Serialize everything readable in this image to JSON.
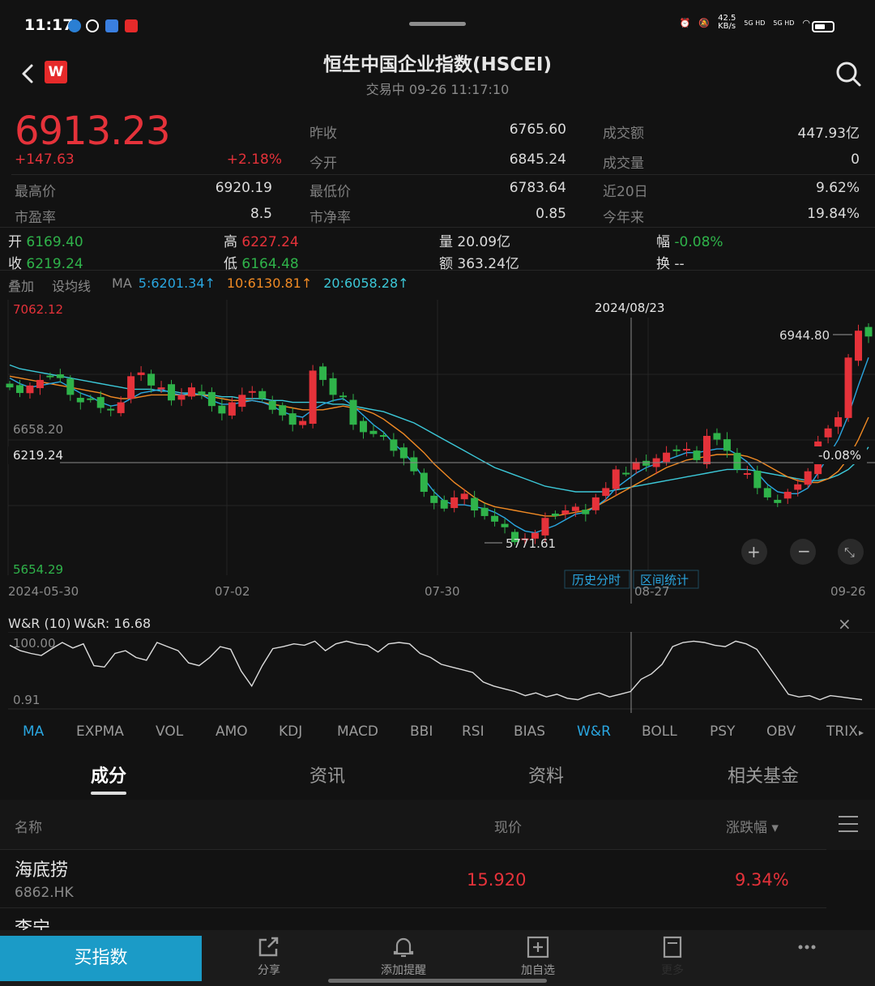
{
  "status_bar": {
    "time": "11:17",
    "net_speed": "42.5\nKB/s",
    "signal1": "5G HD",
    "signal2": "5G HD"
  },
  "header": {
    "title": "恒生中国企业指数(HSCEI)",
    "status": "交易中 09-26 11:17:10",
    "logo": "W"
  },
  "quote": {
    "price": "6913.23",
    "change_abs": "+147.63",
    "change_pct": "+2.18%",
    "fields": [
      {
        "label": "昨收",
        "value": "6765.60"
      },
      {
        "label": "今开",
        "value": "6845.24"
      },
      {
        "label": "成交额",
        "value": "447.93亿"
      },
      {
        "label": "成交量",
        "value": "0"
      },
      {
        "label": "最高价",
        "value": "6920.19"
      },
      {
        "label": "最低价",
        "value": "6783.64"
      },
      {
        "label": "近20日",
        "value": "9.62%"
      },
      {
        "label": "市盈率",
        "value": "8.5"
      },
      {
        "label": "市净率",
        "value": "0.85"
      },
      {
        "label": "今年来",
        "value": "19.84%"
      }
    ]
  },
  "candle_info": {
    "open_label": "开",
    "open": "6169.40",
    "high_label": "高",
    "high": "6227.24",
    "volume_label": "量",
    "volume": "20.09亿",
    "amp_label": "幅",
    "amp": "-0.08%",
    "close_label": "收",
    "close": "6219.24",
    "low_label": "低",
    "low": "6164.48",
    "amount_label": "额",
    "amount": "363.24亿",
    "turnover_label": "换",
    "turnover": "--"
  },
  "ma_legend": {
    "overlay": "叠加",
    "set_ma": "设均线",
    "ma": "MA",
    "ma5": "5:6201.34↑",
    "ma10": "10:6130.81↑",
    "ma20": "20:6058.28↑",
    "ma5_color": "#2aa6e0",
    "ma10_color": "#f08a24",
    "ma20_color": "#3cc8d8"
  },
  "kline": {
    "y_max_label": "7062.12",
    "y_min_label": "5654.29",
    "y_mid_label": "6658.20",
    "cursor_price": "6219.24",
    "cursor_date": "2024/08/23",
    "cursor_pct": "-0.08%",
    "high_marker": "6944.80",
    "low_marker": "5771.61",
    "x_labels": [
      "2024-05-30",
      "07-02",
      "07-30",
      "08-27",
      "09-26"
    ],
    "btn_history": "历史分时",
    "btn_interval": "区间统计",
    "up_color": "#e5323a",
    "down_color": "#2fb34a"
  },
  "chart_data": {
    "type": "line",
    "title": "",
    "candles_close": [
      6640,
      6610,
      6650,
      6680,
      6700,
      6690,
      6600,
      6560,
      6580,
      6530,
      6520,
      6560,
      6700,
      6720,
      6650,
      6640,
      6570,
      6600,
      6640,
      6600,
      6540,
      6500,
      6560,
      6600,
      6620,
      6580,
      6520,
      6490,
      6440,
      6460,
      6730,
      6680,
      6600,
      6590,
      6440,
      6400,
      6390,
      6380,
      6300,
      6260,
      6190,
      6080,
      6020,
      5990,
      6050,
      6070,
      5980,
      5950,
      5920,
      5890,
      5810,
      5830,
      5860,
      5940,
      5950,
      5980,
      6000,
      5960,
      6050,
      6100,
      6200,
      6180,
      6240,
      6220,
      6260,
      6290,
      6300,
      6310,
      6250,
      6380,
      6360,
      6300,
      6200,
      6180,
      6100,
      6050,
      6020,
      6080,
      6120,
      6190,
      6350,
      6420,
      6480,
      6800,
      6944,
      6913
    ],
    "ma5": [
      6690,
      6660,
      6640,
      6650,
      6660,
      6670,
      6640,
      6610,
      6590,
      6560,
      6540,
      6550,
      6580,
      6610,
      6620,
      6630,
      6610,
      6600,
      6610,
      6600,
      6570,
      6550,
      6550,
      6560,
      6570,
      6560,
      6540,
      6510,
      6490,
      6480,
      6520,
      6550,
      6570,
      6580,
      6540,
      6490,
      6440,
      6400,
      6340,
      6290,
      6230,
      6150,
      6080,
      6030,
      6010,
      6010,
      6000,
      5990,
      5970,
      5940,
      5900,
      5870,
      5860,
      5880,
      5900,
      5930,
      5960,
      5970,
      6000,
      6040,
      6100,
      6140,
      6180,
      6210,
      6230,
      6250,
      6270,
      6290,
      6290,
      6300,
      6310,
      6310,
      6280,
      6240,
      6180,
      6120,
      6080,
      6070,
      6070,
      6100,
      6180,
      6270,
      6360,
      6490,
      6650,
      6800
    ],
    "ma10": [
      6700,
      6690,
      6680,
      6670,
      6660,
      6650,
      6640,
      6630,
      6620,
      6610,
      6590,
      6580,
      6580,
      6590,
      6600,
      6600,
      6600,
      6600,
      6600,
      6600,
      6590,
      6580,
      6570,
      6570,
      6570,
      6560,
      6550,
      6540,
      6530,
      6520,
      6520,
      6520,
      6530,
      6540,
      6530,
      6520,
      6500,
      6470,
      6430,
      6390,
      6340,
      6290,
      6230,
      6180,
      6130,
      6090,
      6050,
      6020,
      6000,
      5990,
      5980,
      5970,
      5960,
      5950,
      5950,
      5960,
      5970,
      5980,
      6000,
      6030,
      6060,
      6090,
      6120,
      6150,
      6180,
      6210,
      6230,
      6250,
      6260,
      6270,
      6280,
      6280,
      6280,
      6270,
      6250,
      6220,
      6190,
      6160,
      6140,
      6130,
      6130,
      6150,
      6190,
      6260,
      6360,
      6480
    ],
    "ma20": [
      6760,
      6740,
      6730,
      6720,
      6710,
      6700,
      6690,
      6680,
      6670,
      6660,
      6650,
      6640,
      6630,
      6630,
      6630,
      6620,
      6620,
      6610,
      6610,
      6600,
      6600,
      6590,
      6590,
      6580,
      6580,
      6580,
      6570,
      6570,
      6560,
      6560,
      6560,
      6560,
      6550,
      6550,
      6540,
      6530,
      6520,
      6510,
      6490,
      6470,
      6450,
      6420,
      6390,
      6360,
      6330,
      6300,
      6270,
      6240,
      6210,
      6190,
      6170,
      6150,
      6130,
      6110,
      6100,
      6090,
      6080,
      6080,
      6080,
      6080,
      6090,
      6100,
      6110,
      6120,
      6130,
      6140,
      6150,
      6160,
      6170,
      6180,
      6190,
      6200,
      6200,
      6200,
      6190,
      6180,
      6170,
      6160,
      6150,
      6140,
      6140,
      6150,
      6170,
      6200,
      6250,
      6320
    ],
    "ylim": [
      5654.29,
      7062.12
    ],
    "x_tick_labels": [
      "2024-05-30",
      "07-02",
      "07-30",
      "08-27",
      "09-26"
    ]
  },
  "wr": {
    "title": "W&R (10)",
    "value": "W&R: 16.68",
    "y_top": "100.00",
    "y_bottom": "0.91",
    "series": [
      90,
      82,
      78,
      75,
      85,
      94,
      86,
      92,
      60,
      58,
      78,
      82,
      72,
      68,
      94,
      88,
      82,
      64,
      60,
      72,
      88,
      84,
      52,
      30,
      60,
      85,
      88,
      92,
      90,
      96,
      82,
      92,
      96,
      92,
      90,
      80,
      92,
      94,
      92,
      78,
      72,
      62,
      58,
      54,
      50,
      36,
      30,
      26,
      22,
      16,
      20,
      14,
      18,
      12,
      10,
      16,
      20,
      14,
      18,
      22,
      40,
      48,
      62,
      88,
      94,
      96,
      94,
      90,
      88,
      96,
      92,
      84,
      62,
      40,
      18,
      14,
      16,
      10,
      16,
      14,
      12,
      10
    ],
    "close_icon": "×"
  },
  "indicator_tabs": [
    "MA",
    "EXPMA",
    "VOL",
    "AMO",
    "KDJ",
    "MACD",
    "BBI",
    "RSI",
    "BIAS",
    "W&R",
    "BOLL",
    "PSY",
    "OBV",
    "TRIX"
  ],
  "section_tabs": [
    "成分",
    "资讯",
    "资料",
    "相关基金"
  ],
  "list": {
    "col_name": "名称",
    "col_price": "现价",
    "col_change": "涨跌幅 ▾",
    "rows": [
      {
        "name": "海底捞",
        "code": "6862.HK",
        "price": "15.920",
        "change": "9.34%"
      },
      {
        "name": "李宁",
        "code": "",
        "price": "",
        "change": ""
      }
    ]
  },
  "bottom_bar": {
    "buy": "买指数",
    "share": "分享",
    "alert": "添加提醒",
    "add_watch": "加自选",
    "more_label": "更多"
  }
}
